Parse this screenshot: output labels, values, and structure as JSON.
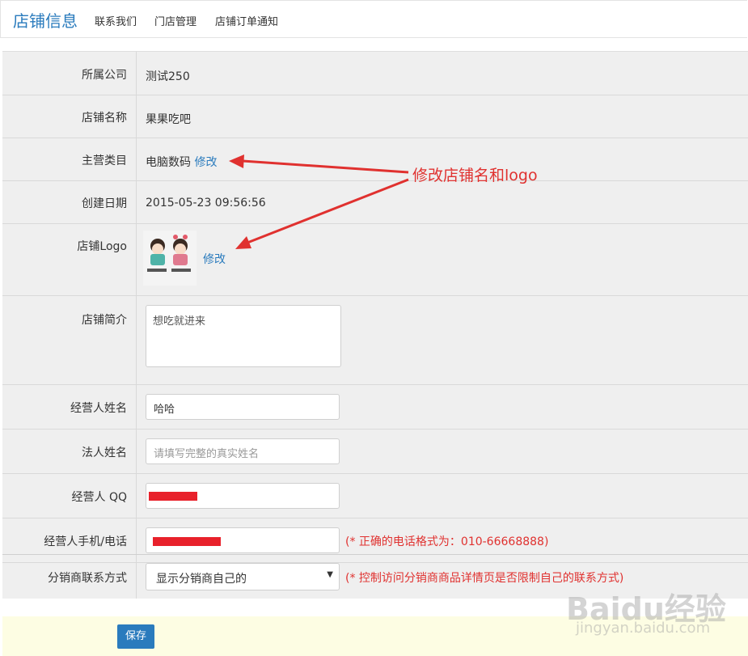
{
  "header": {
    "title": "店铺信息",
    "tabs": [
      "联系我们",
      "门店管理",
      "店铺订单通知"
    ]
  },
  "form": {
    "company_label": "所属公司",
    "company_value": "测试250",
    "shop_name_label": "店铺名称",
    "shop_name_value": "果果吃吧",
    "category_label": "主营类目",
    "category_value": "电脑数码",
    "category_edit": "修改",
    "created_label": "创建日期",
    "created_value": "2015-05-23 09:56:56",
    "logo_label": "店铺Logo",
    "logo_edit": "修改",
    "intro_label": "店铺简介",
    "intro_value": "想吃就进来",
    "operator_label": "经营人姓名",
    "operator_value": "哈哈",
    "legal_label": "法人姓名",
    "legal_placeholder": "请填写完整的真实姓名",
    "qq_label": "经营人 QQ",
    "phone_label": "经营人手机/电话",
    "phone_hint": "(* 正确的电话格式为：010-66668888)",
    "distributor_label": "分销商联系方式",
    "distributor_selected": "显示分销商自己的",
    "distributor_hint": "(* 控制访问分销商商品详情页是否限制自己的联系方式)"
  },
  "footer": {
    "save_label": "保存"
  },
  "annotation": {
    "text": "修改店铺名和logo"
  },
  "watermark": {
    "main": "Baidu经验",
    "sub": "jingyan.baidu.com"
  },
  "colors": {
    "accent": "#2a7bbd",
    "hint_red": "#e0312f",
    "footer_bg": "#fdfde3"
  }
}
